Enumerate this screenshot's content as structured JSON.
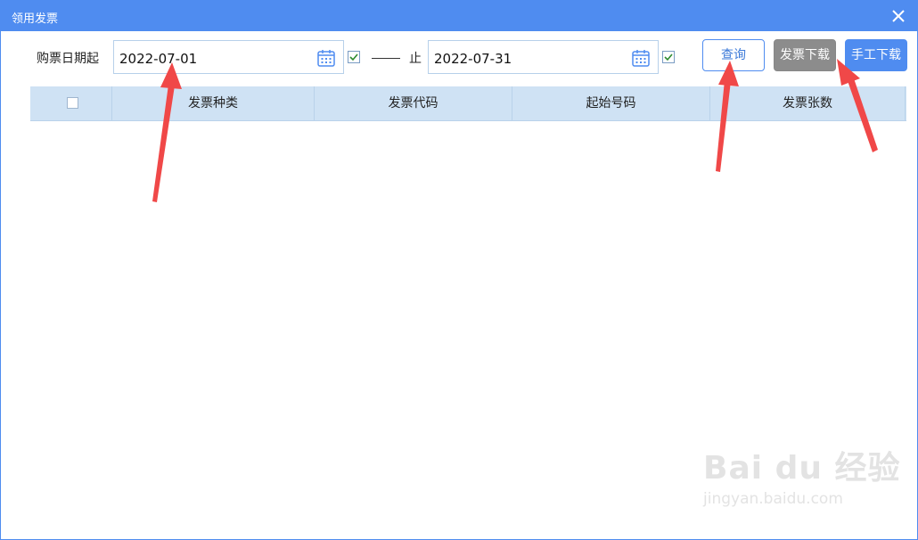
{
  "window": {
    "title": "领用发票"
  },
  "filters": {
    "start_label": "购票日期起",
    "start_date": "2022-07-01",
    "end_label": "止",
    "end_date": "2022-07-31"
  },
  "buttons": {
    "query": "查询",
    "invoice_download": "发票下载",
    "manual_download": "手工下载"
  },
  "table": {
    "columns": [
      "发票种类",
      "发票代码",
      "起始号码",
      "发票张数"
    ]
  },
  "watermark": {
    "main": "Bai du 经验",
    "sub": "jingyan.baidu.com"
  },
  "colors": {
    "titlebar": "#4f8cf0",
    "header": "#cfe2f4",
    "annotation_arrow": "#f04848"
  }
}
